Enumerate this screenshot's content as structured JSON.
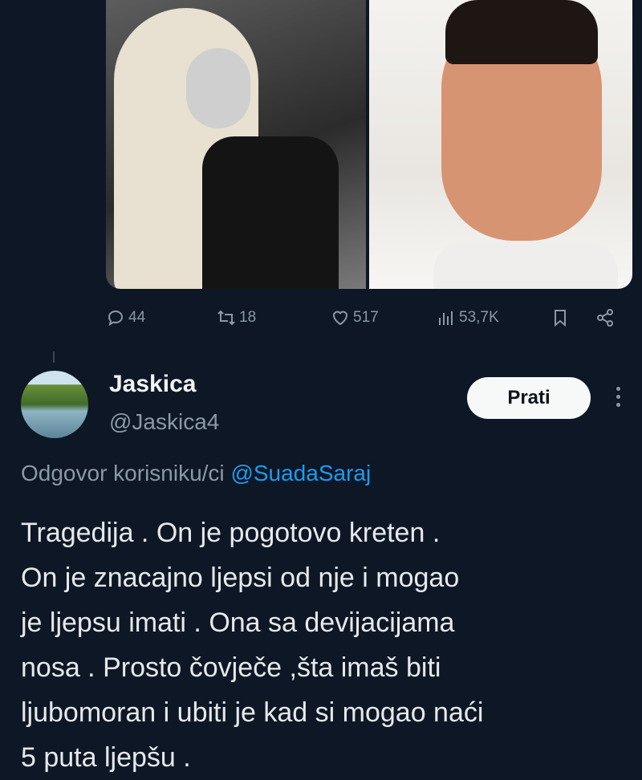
{
  "colors": {
    "background": "#0d1726",
    "muted": "#8b98a5",
    "link": "#1d9bf0",
    "text": "#e7e9ea",
    "button_bg": "#f7f9f9"
  },
  "media": {
    "left_photo": "woman-portrait-photo",
    "right_photo": "man-portrait-photo"
  },
  "actions": {
    "replies": "44",
    "reposts": "18",
    "likes": "517",
    "views": "53,7K",
    "icons": [
      "reply-icon",
      "repost-icon",
      "like-icon",
      "views-icon",
      "bookmark-icon",
      "share-icon"
    ]
  },
  "reply": {
    "name": "Jaskica",
    "handle": "@Jaskica4",
    "follow_label": "Prati",
    "reply_prefix": "Odgovor korisniku/ci",
    "reply_mention": "@SuadaSaraj",
    "lines": [
      "Tragedija . On je pogotovo kreten .",
      "On je znacajno ljepsi od nje i mogao",
      "je ljepsu imati . Ona sa devijacijama",
      "nosa . Prosto čovječe ,šta imaš biti",
      "ljubomoran i ubiti je kad si mogao naći",
      "5 puta ljepšu ."
    ]
  }
}
